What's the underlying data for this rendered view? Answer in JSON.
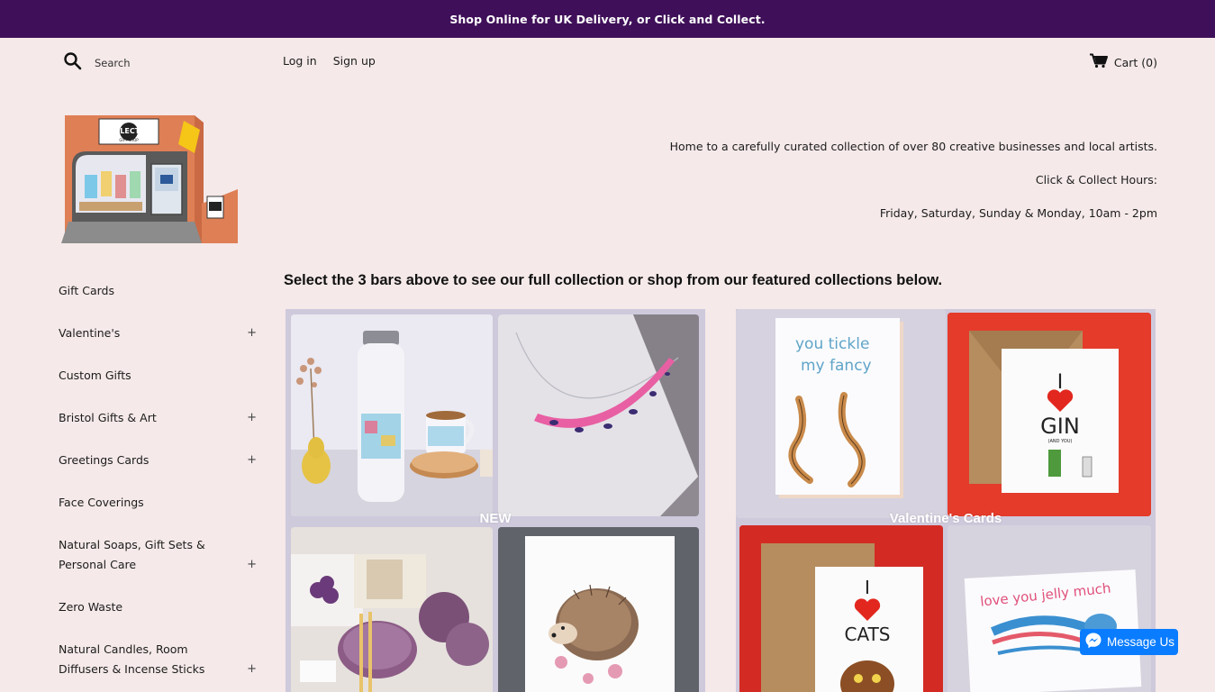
{
  "announcement": "Shop Online for UK Delivery, or Click and Collect.",
  "header": {
    "search_label": "Search",
    "login_label": "Log in",
    "signup_label": "Sign up",
    "cart_label": "Cart (0)"
  },
  "logo": {
    "sign_text": "ECLECTIC",
    "sign_subtext": "GIFT SHOP"
  },
  "tagline": {
    "line1": "Home to a carefully curated collection of over 80 creative businesses and local artists.",
    "line2": "Click & Collect Hours:",
    "line3": "Friday, Saturday, Sunday & Monday, 10am - 2pm"
  },
  "sidebar": {
    "items": [
      {
        "label": "Gift Cards",
        "expandable": false
      },
      {
        "label": "Valentine's",
        "expandable": true
      },
      {
        "label": "Custom Gifts",
        "expandable": false
      },
      {
        "label": "Bristol Gifts & Art",
        "expandable": true
      },
      {
        "label": "Greetings Cards",
        "expandable": true
      },
      {
        "label": "Face Coverings",
        "expandable": false
      },
      {
        "label": "Natural Soaps, Gift Sets & Personal Care",
        "expandable": true
      },
      {
        "label": "Zero Waste",
        "expandable": false
      },
      {
        "label": "Natural Candles, Room Diffusers & Incense Sticks",
        "expandable": true
      }
    ],
    "plus_symbol": "+"
  },
  "main": {
    "headline": "Select the 3 bars above to see our full collection or shop from our featured collections below."
  },
  "collections": [
    {
      "title": "NEW"
    },
    {
      "title": "Valentine's Cards"
    }
  ],
  "cards": {
    "tickle_line1": "you tickle",
    "tickle_line2": "my fancy",
    "gin_i": "I",
    "gin_word": "GIN",
    "cats_i": "I",
    "cats_word": "CATS",
    "jelly": "love you jelly much",
    "and_you": "(AND YOU)"
  },
  "messenger": {
    "label": "Message Us"
  },
  "colors": {
    "announcement_bg": "#3f1059",
    "page_bg": "#f5e9e9",
    "messenger_blue": "#0a7cff"
  }
}
